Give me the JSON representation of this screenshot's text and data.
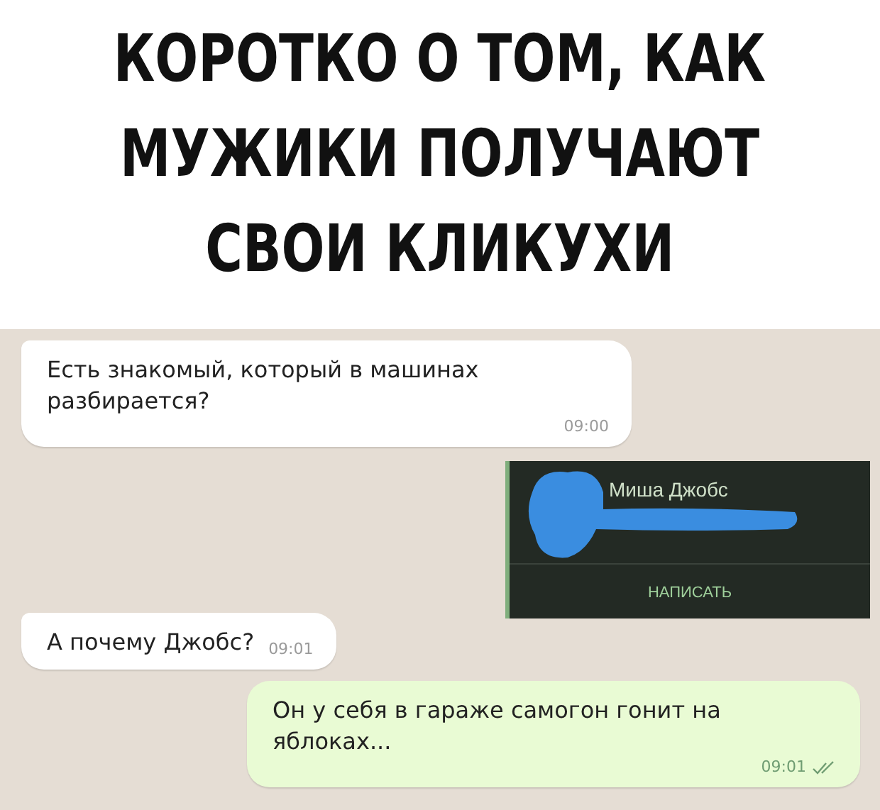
{
  "caption": [
    "КОРОТКО О ТОМ, КАК",
    "МУЖИКИ ПОЛУЧАЮТ",
    "СВОИ КЛИКУХИ"
  ],
  "messages": [
    {
      "kind": "in",
      "text": "Есть знакомый, который в машинах разбирается?",
      "time": "09:00"
    },
    {
      "kind": "contact",
      "name": "Миша Джобс",
      "action": "НАПИСАТЬ"
    },
    {
      "kind": "in",
      "text": "А почему Джобс?",
      "time": "09:01"
    },
    {
      "kind": "out",
      "text": "Он у себя в гараже самогон гонит на яблоках...",
      "time": "09:01",
      "read": true
    }
  ]
}
